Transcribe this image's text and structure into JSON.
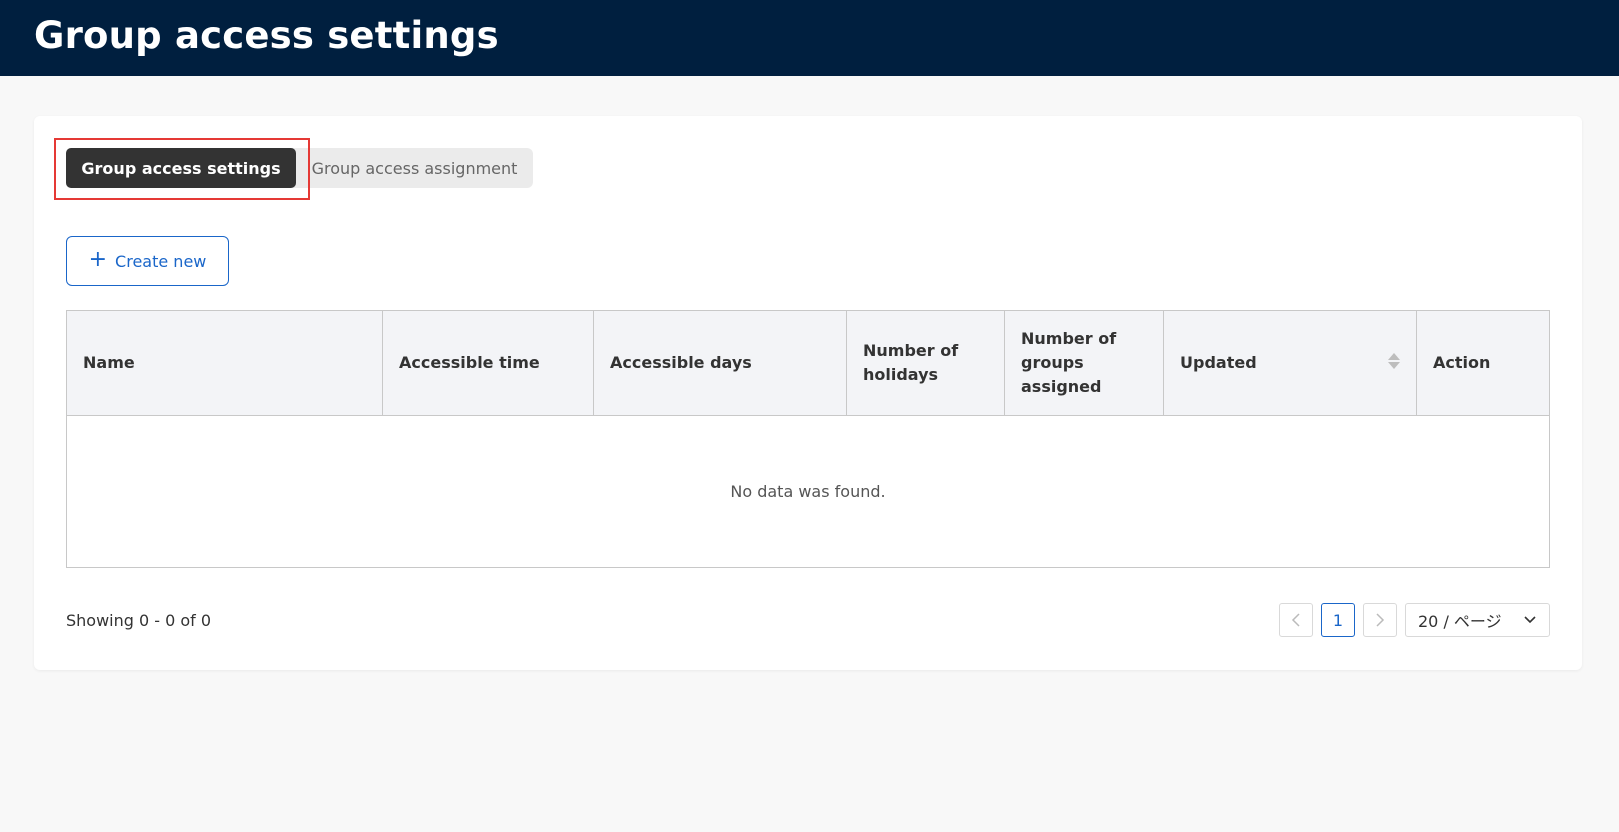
{
  "header": {
    "title": "Group access settings"
  },
  "tabs": [
    {
      "label": "Group access settings",
      "active": true
    },
    {
      "label": "Group access assignment",
      "active": false
    }
  ],
  "toolbar": {
    "create_label": "Create new",
    "create_icon": "plus-icon"
  },
  "table": {
    "columns": [
      {
        "label": "Name"
      },
      {
        "label": "Accessible time"
      },
      {
        "label": "Accessible days"
      },
      {
        "label": "Number of holidays"
      },
      {
        "label": "Number of groups assigned"
      },
      {
        "label": "Updated",
        "sortable": true
      },
      {
        "label": "Action"
      }
    ],
    "rows": [],
    "empty_text": "No data was found."
  },
  "pagination": {
    "showing": "Showing 0 - 0 of 0",
    "current_page": "1",
    "page_size": "20 / ページ"
  },
  "colors": {
    "header_bg": "#001f3f",
    "accent": "#1a66c9",
    "active_tab_bg": "#333333",
    "highlight": "#e53935"
  }
}
